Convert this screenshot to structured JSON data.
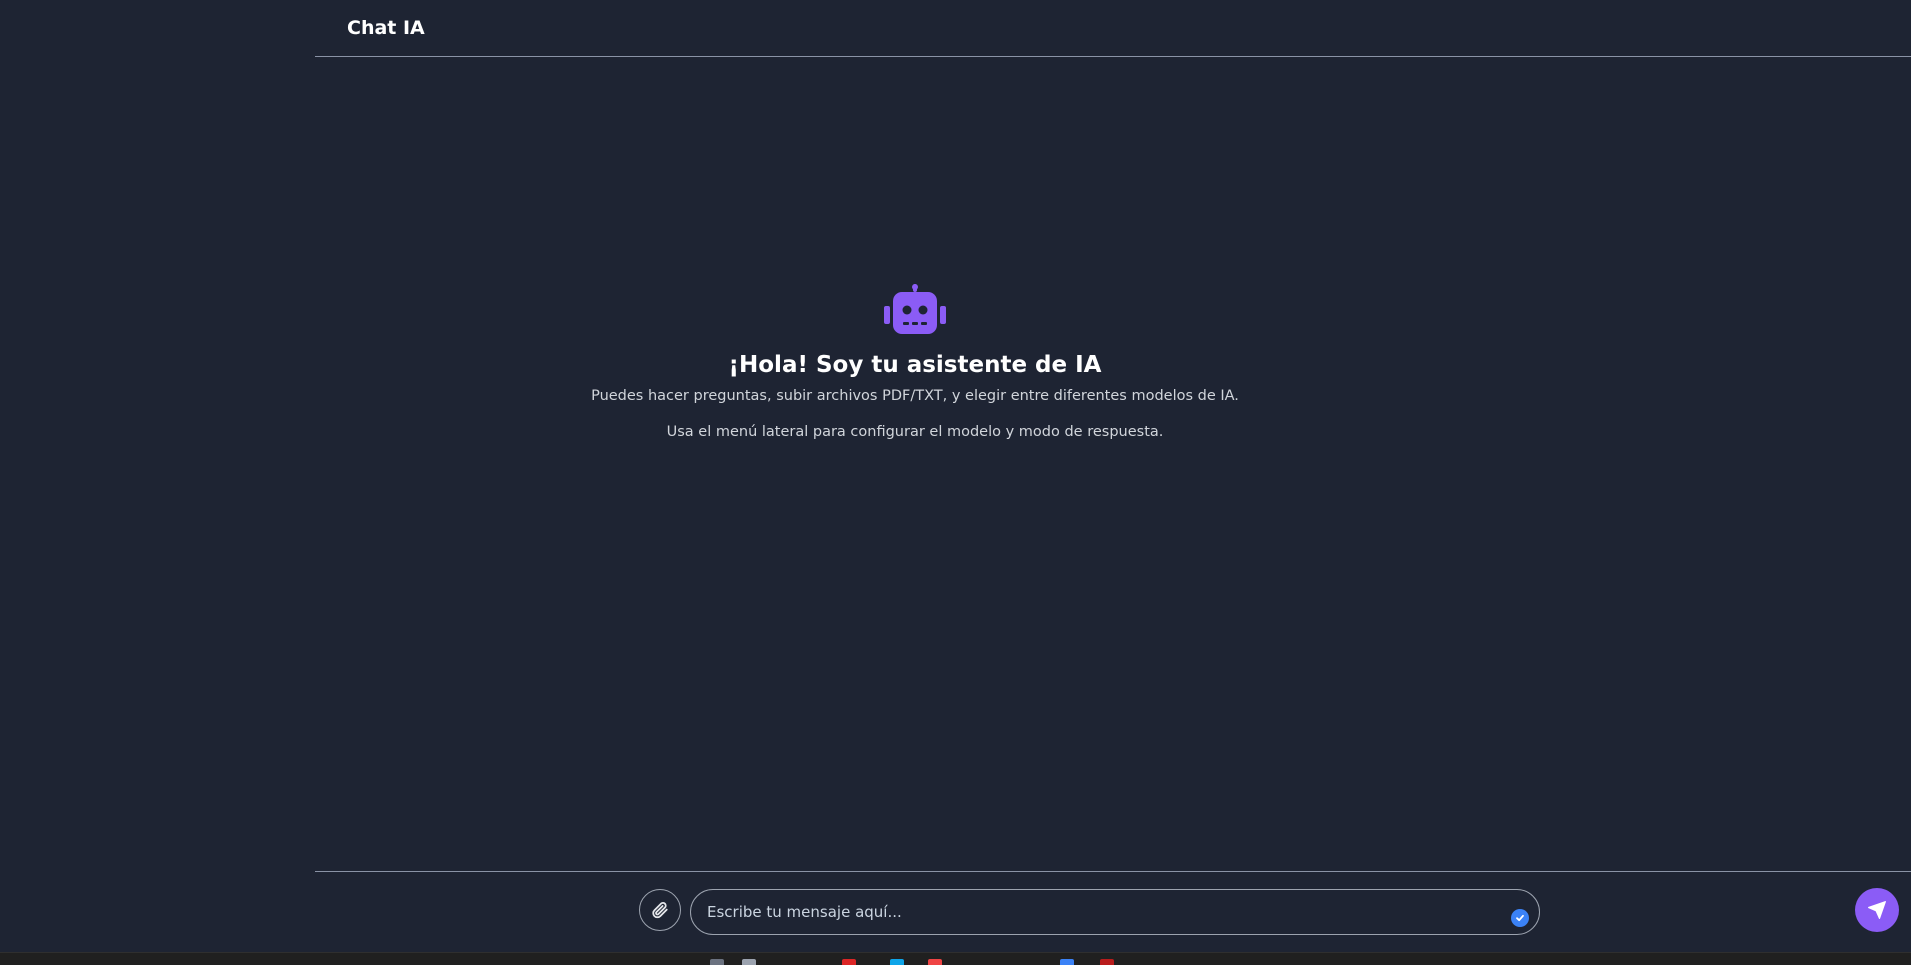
{
  "header": {
    "title": "Chat IA"
  },
  "welcome": {
    "icon": "robot-icon",
    "icon_color": "#8b5cf6",
    "title": "¡Hola! Soy tu asistente de IA",
    "subtitle": "Puedes hacer preguntas, subir archivos PDF/TXT, y elegir entre diferentes modelos de IA.",
    "hint": "Usa el menú lateral para configurar el modelo y modo de respuesta."
  },
  "composer": {
    "attach_icon": "paperclip-icon",
    "placeholder": "Escribe tu mensaje aquí...",
    "check_icon": "check-badge-icon",
    "send_icon": "send-icon",
    "accent": "#8b5cf6"
  },
  "colors": {
    "background": "#1e2433",
    "divider": "#8a93a6"
  }
}
